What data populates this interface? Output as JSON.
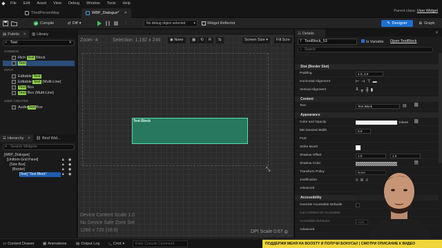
{
  "menu": [
    "File",
    "Edit",
    "Asset",
    "View",
    "Debug",
    "Window",
    "Tools",
    "Help"
  ],
  "tabs": [
    {
      "label": "ThirdPersonMap"
    },
    {
      "label": "WBP_Dialogue*"
    }
  ],
  "parent_class": {
    "label": "Parent class:",
    "value": "User Widget"
  },
  "toolbar": {
    "compile": "Compile",
    "diff": "Diff",
    "debug_select": "No debug object selected",
    "widget_reflector": "Widget Reflector",
    "designer": "Designer",
    "graph": "Graph"
  },
  "palette": {
    "tab_palette": "Palette",
    "tab_library": "Library",
    "search_value": "Text",
    "categories": {
      "common": "COMMON",
      "input": "INPUT",
      "user_created": "USER CREATED"
    },
    "common_items": [
      {
        "pre": "Rich ",
        "hl": "Text",
        "post": " Block"
      },
      {
        "pre": "",
        "hl": "Text",
        "post": ""
      }
    ],
    "input_items": [
      {
        "pre": "Editable ",
        "hl": "Text",
        "post": ""
      },
      {
        "pre": "Editable ",
        "hl": "Text",
        "post": " (Multi-Line)"
      },
      {
        "pre": "",
        "hl": "Text",
        "post": " Box"
      },
      {
        "pre": "",
        "hl": "Text",
        "post": " Box (Multi-Line)"
      }
    ],
    "user_items": [
      {
        "pre": "Audio",
        "hl": "Text",
        "post": "Box"
      }
    ]
  },
  "hierarchy": {
    "tab_hierarchy": "Hierarchy",
    "tab_bind": "Bind Wid...",
    "search_placeholder": "Search Widgets",
    "items": [
      "[WBP_Dialogue]",
      "[Uniform Grid Panel]",
      "[Size Box]",
      "[Border]",
      "[Text] \"Text Block\""
    ]
  },
  "viewport": {
    "zoom": "Zoom -4",
    "selection": "Selection: 1,192 x 246",
    "none_label": "None",
    "screen_size": "Screen Size",
    "fill_screen": "Fill Scre",
    "widget_text": "Text Block",
    "device_scale": "Device Content Scale 1.0",
    "safe_zone": "No Device Safe Zone Set",
    "resolution": "1280 x 720 (16:9)",
    "dpi": "DPI Scale 0.67"
  },
  "details": {
    "tab": "Details",
    "widget_name": "TextBlock_53",
    "is_variable": "Is Variable",
    "open_link": "Open TextBlock",
    "search_placeholder": "Search",
    "sections": {
      "slot": "Slot (Border Slot)",
      "content": "Content",
      "appearance": "Appearance",
      "accessibility": "Accessibility"
    },
    "rows": {
      "padding": {
        "label": "Padding",
        "value": "4.0, 2.0"
      },
      "h_align": "Horizontal Alignment",
      "v_align": "Vertical Alignment",
      "text": {
        "label": "Text",
        "value": "Text Block"
      },
      "color": {
        "label": "Color and Opacity",
        "inherit": "Inherit"
      },
      "min_width": {
        "label": "Min Desired Width",
        "value": "0.0"
      },
      "font": "Font",
      "strike": "Strike Brush",
      "shadow_offset": {
        "label": "Shadow Offset",
        "x": "1.0",
        "y": "1.0"
      },
      "shadow_color": "Shadow Color",
      "transform": {
        "label": "Transform Policy",
        "value": "None"
      },
      "justification": "Justification",
      "advanced": "Advanced",
      "override": "Override Accessible Defaults",
      "can_children": "Can Children be Accessible",
      "acc_behavior": {
        "label": "Accessible Behavior",
        "value": "Auto"
      },
      "advanced2": "Advanced"
    }
  },
  "bottombar": {
    "content_drawer": "Content Drawer",
    "animations": "Animations",
    "output_log": "Output Log",
    "cmd": "Cmd",
    "console_placeholder": "Enter Console Command",
    "ticker": "ПОДДЕРЖИ МЕНЯ НА BOOSTY И ПОЛУЧИ БОНУСЫ! | СМОТРИ ОПИСАНИЕ К ВИДЕО"
  },
  "colors": {
    "accent": "#1d6fd0",
    "selection": "#58e0b0",
    "highlight": "#8fd14f",
    "ticker": "#f0d63a"
  }
}
